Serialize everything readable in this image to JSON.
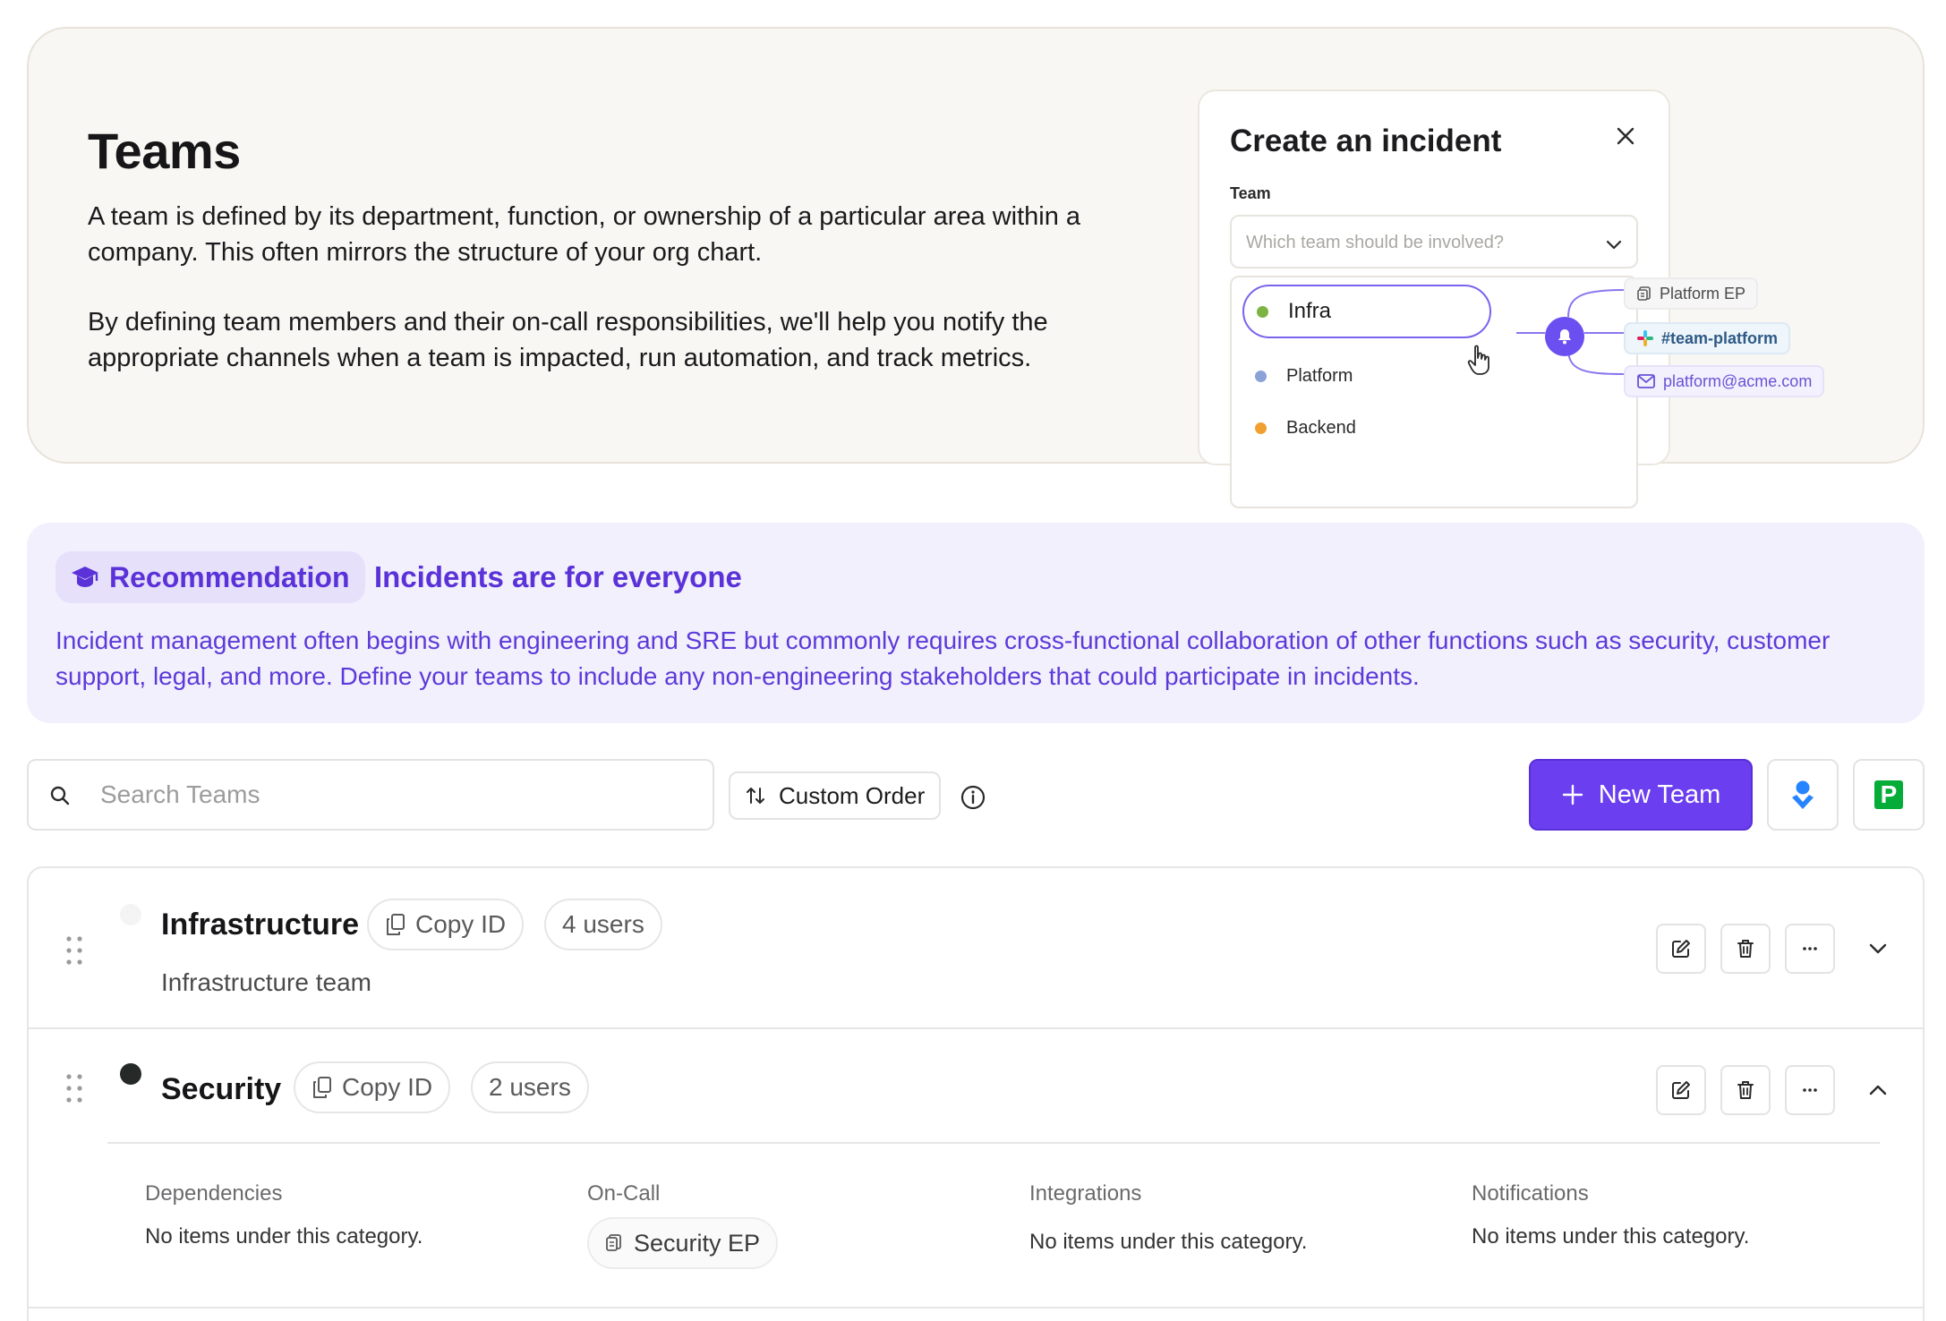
{
  "hero": {
    "title": "Teams",
    "paragraph1": "A team is defined by its department, function, or ownership of a particular area within a company. This often mirrors the structure of your org chart.",
    "paragraph2": "By defining team members and their on-call responsibilities, we'll help you notify the appropriate channels when a team is impacted, run automation, and track metrics.",
    "mock": {
      "title": "Create an incident",
      "team_label": "Team",
      "select_placeholder": "Which team should be involved?",
      "options": [
        {
          "label": "Infra",
          "color": "#7cb342"
        },
        {
          "label": "Platform",
          "color": "#8aa2d8"
        },
        {
          "label": "Backend",
          "color": "#f0a030"
        }
      ],
      "chips": {
        "escalation": "Platform EP",
        "slack": "#team-platform",
        "email": "platform@acme.com"
      }
    }
  },
  "recommendation": {
    "badge": "Recommendation",
    "title": "Incidents are for everyone",
    "body": "Incident management often begins with engineering and SRE but commonly requires cross-functional collaboration of other functions such as security, customer support, legal, and more. Define your teams to include any non-engineering stakeholders that could participate in incidents."
  },
  "toolbar": {
    "search_placeholder": "Search Teams",
    "order_label": "Custom Order",
    "new_team_label": "New Team",
    "pagerduty_letter": "P"
  },
  "teams": [
    {
      "name": "Infrastructure",
      "copy_label": "Copy ID",
      "users": "4 users",
      "description": "Infrastructure team",
      "expanded": false
    },
    {
      "name": "Security",
      "copy_label": "Copy ID",
      "users": "2 users",
      "expanded": true,
      "categories": {
        "dependencies": {
          "label": "Dependencies",
          "empty": "No items under this category."
        },
        "oncall": {
          "label": "On-Call",
          "item": "Security EP"
        },
        "integrations": {
          "label": "Integrations",
          "empty": "No items under this category."
        },
        "notifications": {
          "label": "Notifications",
          "empty": "No items under this category."
        }
      }
    }
  ],
  "colors": {
    "accent": "#6b3ff0",
    "recommendation_bg": "#f2f0fc",
    "hero_bg": "#f9f7f3"
  }
}
